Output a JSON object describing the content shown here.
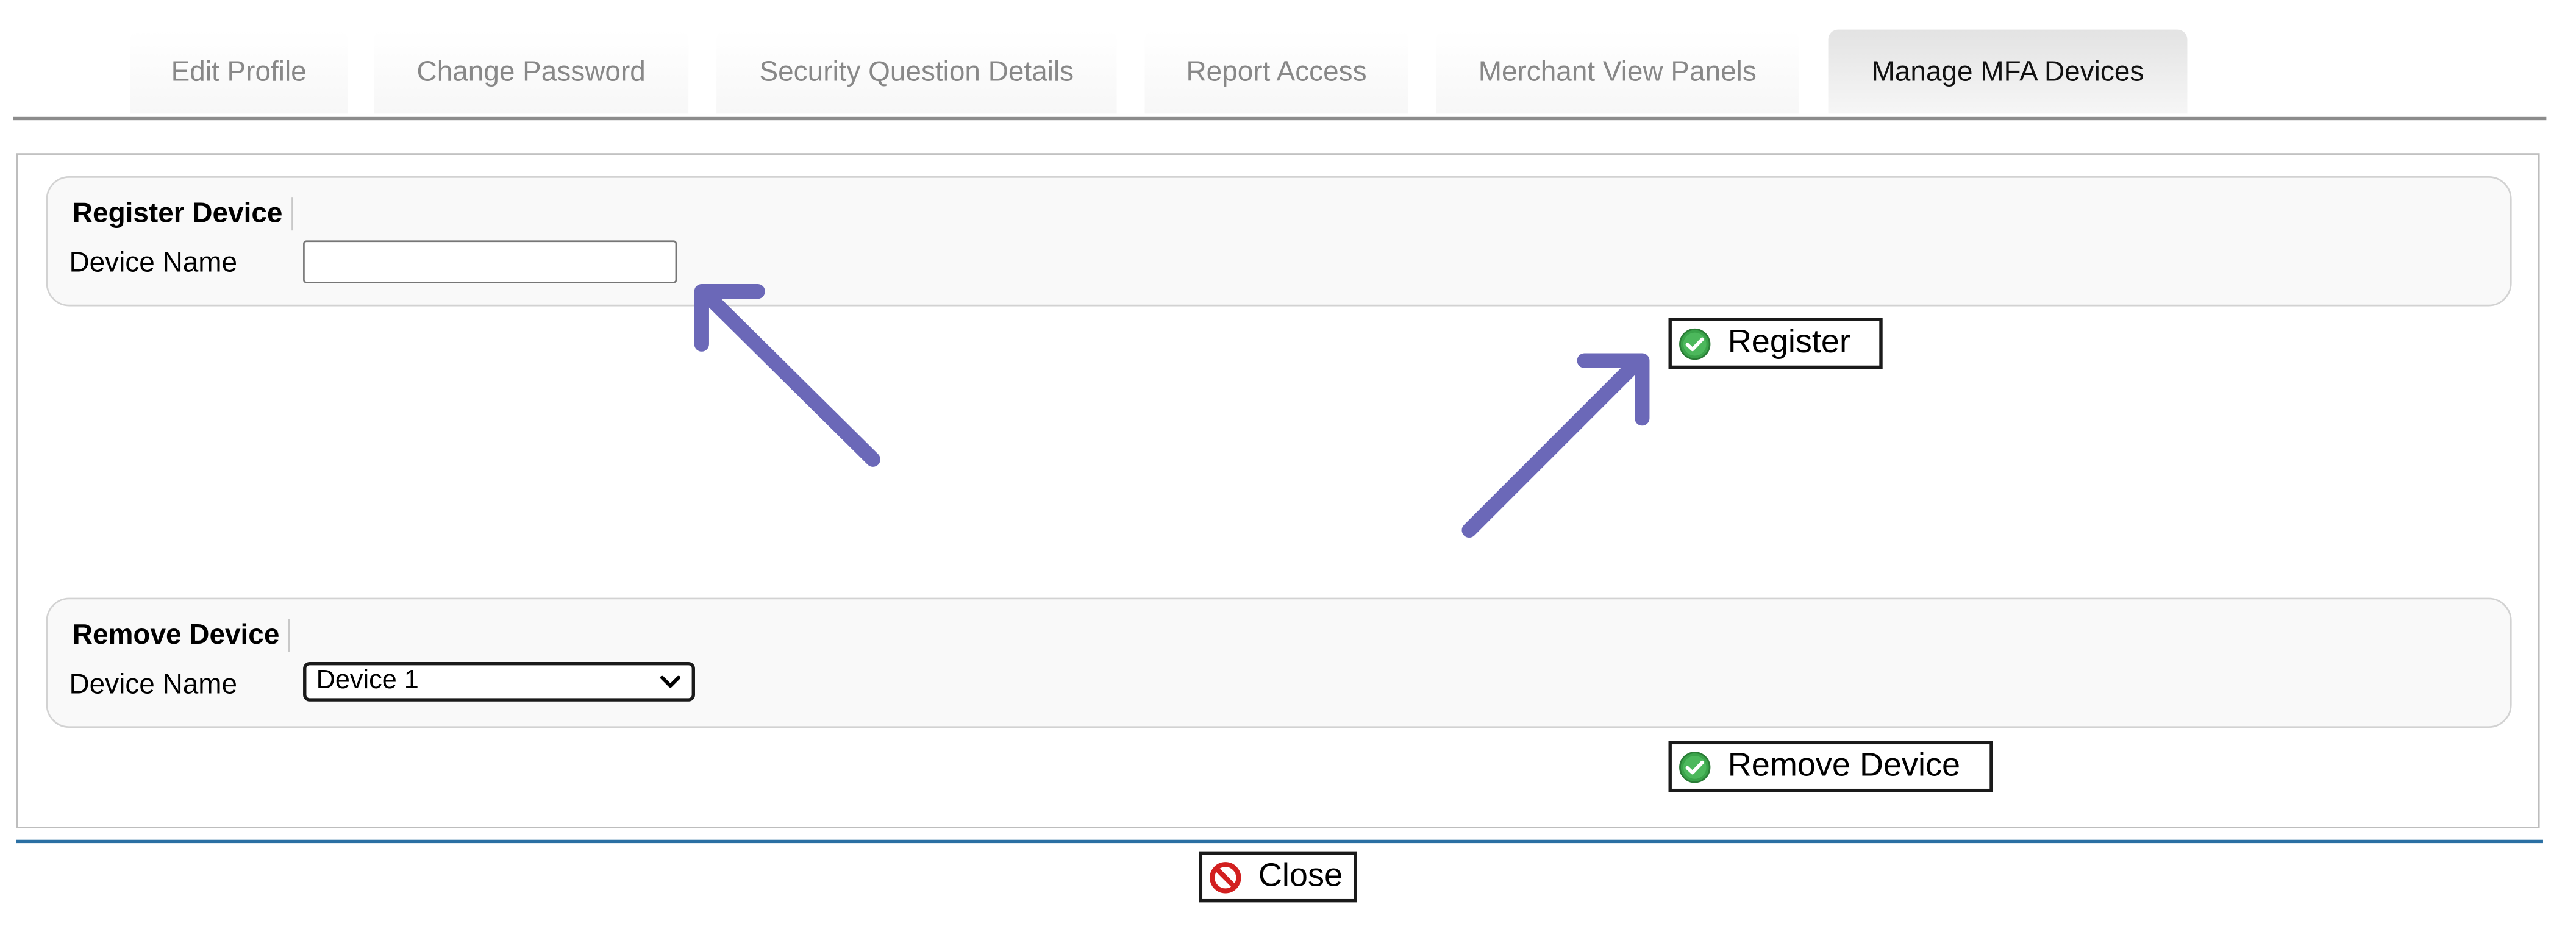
{
  "tabs": [
    {
      "label": "Edit Profile",
      "active": false
    },
    {
      "label": "Change Password",
      "active": false
    },
    {
      "label": "Security Question Details",
      "active": false
    },
    {
      "label": "Report Access",
      "active": false
    },
    {
      "label": "Merchant View Panels",
      "active": false
    },
    {
      "label": "Manage MFA Devices",
      "active": true
    }
  ],
  "register_section": {
    "title": "Register Device",
    "field_label": "Device Name",
    "input_value": "",
    "button_label": "Register"
  },
  "remove_section": {
    "title": "Remove Device",
    "field_label": "Device Name",
    "selected_device": "Device 1",
    "button_label": "Remove Device"
  },
  "close_button": {
    "label": "Close"
  },
  "icons": {
    "confirm": "check-circle-icon",
    "close": "no-entry-icon",
    "select": "chevron-down-icon",
    "annotation": "arrow-icon"
  },
  "colors": {
    "annotation_arrow": "#6b68b8",
    "active_tab_bg": "#e6e6e6",
    "inactive_tab_text": "#888888",
    "bottom_rule": "#2a6fa3",
    "check_green": "#3aa34a",
    "close_red": "#d22020"
  }
}
